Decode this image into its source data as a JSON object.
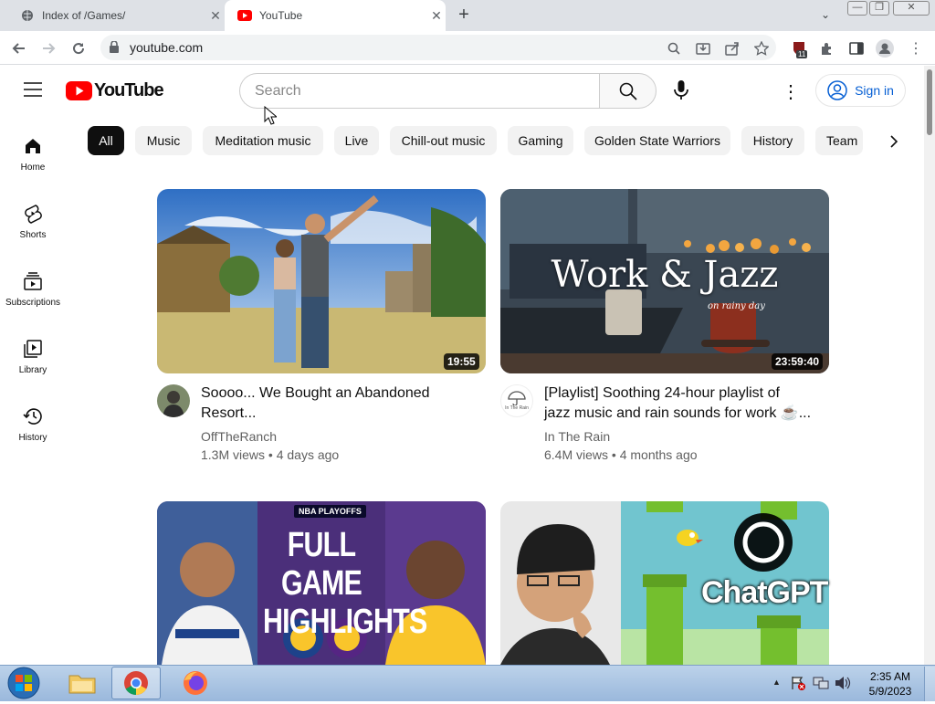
{
  "browser": {
    "tabs": [
      {
        "title": "Index of /Games/",
        "active": false
      },
      {
        "title": "YouTube",
        "active": true
      }
    ],
    "url": "youtube.com",
    "extension_badge": "11"
  },
  "youtube": {
    "logo_text": "YouTube",
    "search_placeholder": "Search",
    "sign_in_label": "Sign in",
    "chips": [
      "All",
      "Music",
      "Meditation music",
      "Live",
      "Chill-out music",
      "Gaming",
      "Golden State Warriors",
      "History",
      "Team"
    ],
    "sidebar": [
      {
        "label": "Home",
        "icon": "home-icon"
      },
      {
        "label": "Shorts",
        "icon": "shorts-icon"
      },
      {
        "label": "Subscriptions",
        "icon": "subscriptions-icon"
      },
      {
        "label": "Library",
        "icon": "library-icon"
      },
      {
        "label": "History",
        "icon": "history-icon"
      }
    ],
    "videos": [
      {
        "title_line1": "Soooo... We Bought an Abandoned",
        "title_line2": "Resort...",
        "channel": "OffTheRanch",
        "stats": "1.3M views • 4 days ago",
        "duration": "19:55"
      },
      {
        "title_line1": "[Playlist] Soothing 24-hour playlist of",
        "title_line2": "jazz music and rain sounds for work ☕...",
        "channel": "In The Rain",
        "stats": "6.4M views • 4 months ago",
        "duration": "23:59:40",
        "thumb_text": "Work & Jazz",
        "thumb_subtext": "on rainy day",
        "avatar_text": "In The Rain"
      },
      {
        "thumb_badge": "NBA PLAYOFFS",
        "thumb_line1": "FULL GAME",
        "thumb_line2": "HIGHLIGHTS"
      },
      {
        "thumb_text": "ChatGPT"
      }
    ]
  },
  "taskbar": {
    "time": "2:35 AM",
    "date": "5/9/2023"
  },
  "colors": {
    "yt_red": "#ff0000",
    "link_blue": "#065fd4",
    "tab_strip": "#dee1e6"
  }
}
